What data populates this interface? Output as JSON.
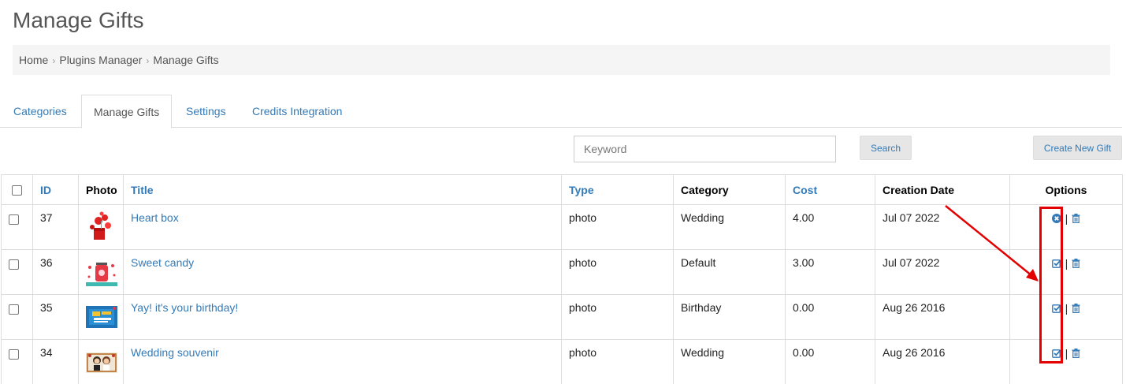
{
  "page": {
    "title": "Manage Gifts"
  },
  "breadcrumb": {
    "items": [
      "Home",
      "Plugins Manager",
      "Manage Gifts"
    ]
  },
  "tabs": [
    {
      "label": "Categories"
    },
    {
      "label": "Manage Gifts"
    },
    {
      "label": "Settings"
    },
    {
      "label": "Credits Integration"
    }
  ],
  "search": {
    "placeholder": "Keyword",
    "value": "",
    "button_label": "Search"
  },
  "toolbar": {
    "create_label": "Create New Gift"
  },
  "table": {
    "headers": {
      "id": "ID",
      "photo": "Photo",
      "title": "Title",
      "type": "Type",
      "category": "Category",
      "cost": "Cost",
      "date": "Creation Date",
      "options": "Options"
    },
    "rows": [
      {
        "id": "37",
        "title": "Heart box",
        "type": "photo",
        "category": "Wedding",
        "cost": "4.00",
        "date": "Jul 07 2022",
        "status_icon": "circle-x-icon"
      },
      {
        "id": "36",
        "title": "Sweet candy",
        "type": "photo",
        "category": "Default",
        "cost": "3.00",
        "date": "Jul 07 2022",
        "status_icon": "checkbox-checked-icon"
      },
      {
        "id": "35",
        "title": "Yay! it's your birthday!",
        "type": "photo",
        "category": "Birthday",
        "cost": "0.00",
        "date": "Aug 26 2016",
        "status_icon": "checkbox-checked-icon"
      },
      {
        "id": "34",
        "title": "Wedding souvenir",
        "type": "photo",
        "category": "Wedding",
        "cost": "0.00",
        "date": "Aug 26 2016",
        "status_icon": "checkbox-checked-icon"
      }
    ]
  },
  "colors": {
    "link": "#337ab7",
    "annotation": "#e30000",
    "breadcrumb_bg": "#f5f5f5"
  }
}
